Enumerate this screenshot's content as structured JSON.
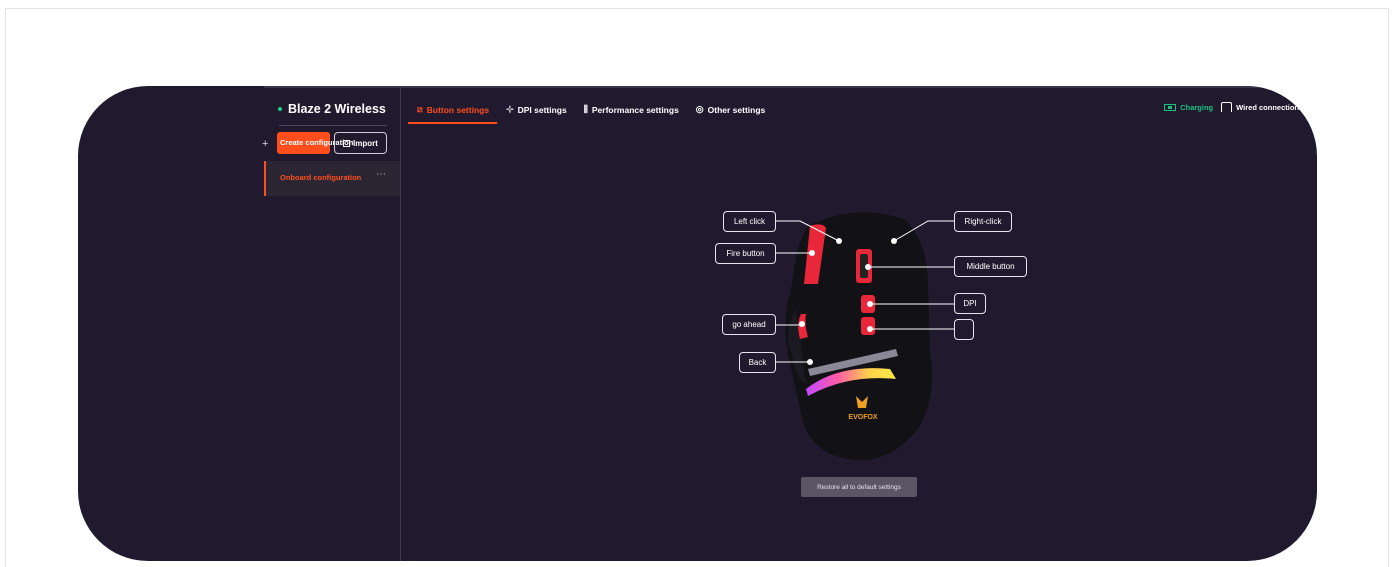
{
  "sidebar": {
    "device_name": "Blaze 2 Wireless",
    "plus_glyph": "+",
    "create_label": "Create configuration",
    "import_label": "Import",
    "configs": [
      {
        "label": "Onboard configuration",
        "more": "⋯"
      }
    ]
  },
  "tabs": [
    {
      "label": "Button settings",
      "icon": "settings-icon",
      "glyph": "⧄"
    },
    {
      "label": "DPI settings",
      "icon": "crosshair-icon",
      "glyph": "⊹"
    },
    {
      "label": "Performance settings",
      "icon": "sliders-icon",
      "glyph": "⫼"
    },
    {
      "label": "Other settings",
      "icon": "gear-icon",
      "glyph": "◎"
    }
  ],
  "status": {
    "charging_label": "Charging",
    "wired_label": "Wired connection"
  },
  "callouts": {
    "left_click": "Left click",
    "fire": "Fire button",
    "go_ahead": "go ahead",
    "back": "Back",
    "right_click": "Right-click",
    "middle": "Middle button",
    "dpi": "DPI",
    "unnamed": ""
  },
  "mouse": {
    "brand": "EVOFOX"
  },
  "restore_label": "Restore all to default settings",
  "colors": {
    "accent": "#ff4e1c",
    "background": "#211a2f",
    "charging": "#19c27e"
  }
}
